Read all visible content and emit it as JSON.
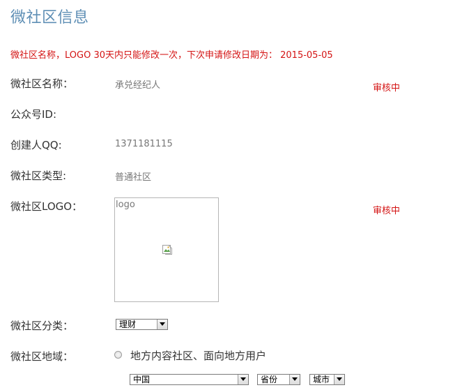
{
  "page": {
    "title": "微社区信息",
    "notice": "微社区名称，LOGO 30天内只能修改一次，下次申请修改日期为： 2015-05-05"
  },
  "fields": {
    "name": {
      "label": "微社区名称：",
      "value": "承兑经纪人",
      "status": "审核中"
    },
    "public_id": {
      "label": "公众号ID:",
      "value": ""
    },
    "creator_qq": {
      "label": "创建人QQ:",
      "value": "1371181115"
    },
    "type": {
      "label": "微社区类型:",
      "value": "普通社区"
    },
    "logo": {
      "label": "微社区LOGO：",
      "alt_text": "logo",
      "status": "审核中"
    },
    "category": {
      "label": "微社区分类：",
      "selected": "理财"
    },
    "region": {
      "label": "微社区地域：",
      "option_label": "地方内容社区、面向地方用户",
      "option_checked": false,
      "country_selected": "中国",
      "province_selected": "省份",
      "city_selected": "城市"
    }
  },
  "colors": {
    "title": "#5f8fb5",
    "notice": "#d41414",
    "label": "#333333",
    "value": "#777777",
    "status": "#d41414"
  },
  "icons": {
    "logo_image": "broken-image-icon",
    "select_arrow": "chevron-down-icon"
  }
}
